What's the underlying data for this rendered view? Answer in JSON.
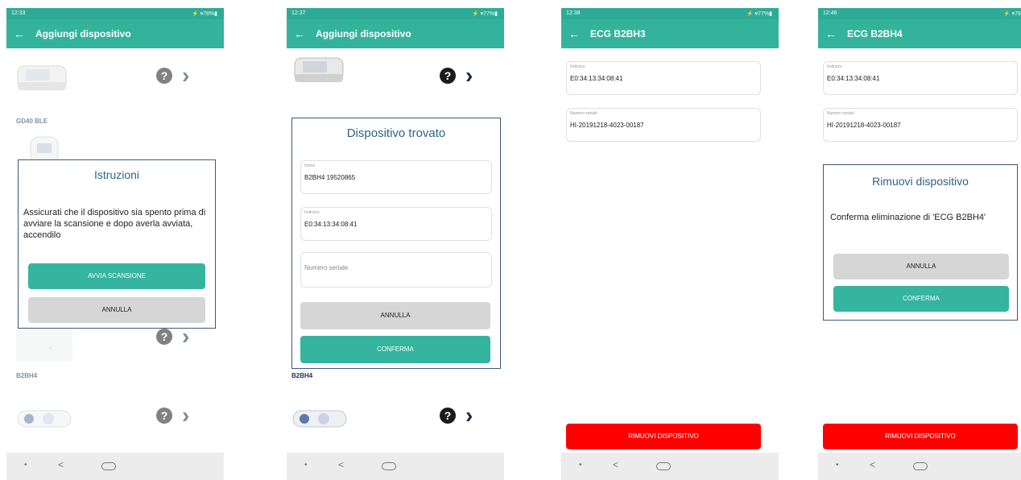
{
  "colors": {
    "primary": "#34b39c",
    "status_bar": "#2eab96",
    "danger": "#ff0000",
    "dialog_title": "#2d6488"
  },
  "screens": [
    {
      "status": {
        "time": "12:33",
        "icons": "⚡ ▾78%▮"
      },
      "appbar": {
        "back_icon": "←",
        "title": "Aggiungi dispositivo"
      },
      "devices": [
        {
          "name": "GD40 BLE"
        },
        {
          "name": "B2BH4"
        }
      ],
      "dialog": {
        "title": "Istruzioni",
        "text": "Assicurati che il dispositivo sia spento prima di avviare la scansione e dopo averla avviata, accendilo",
        "start_label": "AVVIA SCANSIONE",
        "cancel_label": "ANNULLA"
      },
      "nav": {
        "recents": "•",
        "back": "<"
      }
    },
    {
      "status": {
        "time": "12:37",
        "icons": "⚡ ▾77%▮"
      },
      "appbar": {
        "back_icon": "←",
        "title": "Aggiungi dispositivo"
      },
      "devices": [
        {
          "name": "B2BH4"
        }
      ],
      "dialog": {
        "title": "Dispositivo trovato",
        "fields": [
          {
            "label": "Nome",
            "value": "B2BH4 19520865"
          },
          {
            "label": "Indirizzo",
            "value": "E0:34:13:34:08:41"
          },
          {
            "label": "",
            "value": "",
            "placeholder": "Numero seriale"
          }
        ],
        "cancel_label": "ANNULLA",
        "confirm_label": "CONFERMA"
      },
      "nav": {
        "recents": "•",
        "back": "<"
      }
    },
    {
      "status": {
        "time": "12:38",
        "icons": "⚡ ▾77%▮"
      },
      "appbar": {
        "back_icon": "←",
        "title": "ECG B2BH3"
      },
      "fields": [
        {
          "label": "Indirizzo",
          "value": "E0:34:13:34:08:41"
        },
        {
          "label": "Numero seriale",
          "value": "HI-20191218-4023-00187"
        }
      ],
      "remove_label": "RIMUOVI DISPOSITIVO",
      "nav": {
        "recents": "•",
        "back": "<"
      }
    },
    {
      "status": {
        "time": "12:46",
        "icons": "⚡ ▾76%▮"
      },
      "appbar": {
        "back_icon": "←",
        "title": "ECG B2BH4"
      },
      "fields": [
        {
          "label": "Indirizzo",
          "value": "E0:34:13:34:08:41"
        },
        {
          "label": "Numero seriale",
          "value": "HI-20191218-4023-00187"
        }
      ],
      "dialog": {
        "title": "Rimuovi dispositivo",
        "text": "Conferma eliminazione di 'ECG B2BH4'",
        "cancel_label": "ANNULLA",
        "confirm_label": "CONFERMA"
      },
      "remove_label": "RIMUOVI DISPOSITIVO",
      "nav": {
        "recents": "•",
        "back": "<"
      }
    }
  ]
}
